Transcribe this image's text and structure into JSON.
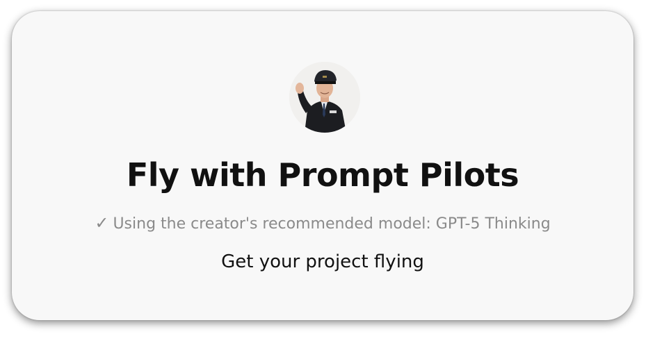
{
  "gpt": {
    "title": "Fly with Prompt Pilots",
    "model_note": "Using the creator's recommended model: GPT-5 Thinking",
    "description": "Get your project flying",
    "avatar_icon": "pilot-avatar"
  },
  "colors": {
    "card_background": "#f8f8f8",
    "title_text": "#111111",
    "muted_text": "#8a8a8a"
  }
}
